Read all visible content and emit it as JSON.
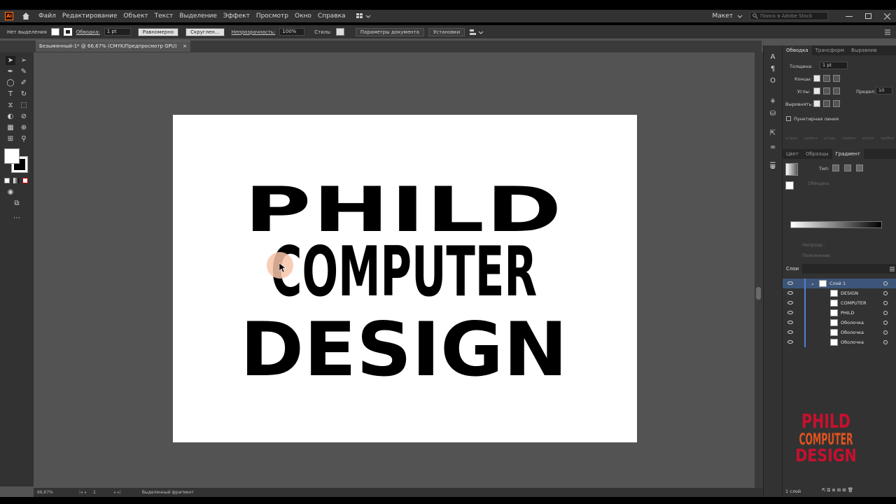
{
  "menubar": {
    "items": [
      "Файл",
      "Редактирование",
      "Объект",
      "Текст",
      "Выделение",
      "Эффект",
      "Просмотр",
      "Окно",
      "Справка"
    ],
    "workspace": "Макет",
    "search_placeholder": "Поиск в Adobe Stock",
    "app_logo": "Ai"
  },
  "controlbar": {
    "selection_label": "Нет выделения",
    "stroke_label": "Обводка:",
    "stroke_value": "1 pt",
    "profile_label": "Равномерно",
    "brush_label": "Скруглен...",
    "opacity_label": "Непрозрачность:",
    "opacity_value": "100%",
    "style_label": "Стиль:",
    "doc_settings": "Параметры документа",
    "preferences": "Установки"
  },
  "document_tab": "Безымянный-1* @ 66,67% (CMYK/Предпросмотр GPU)",
  "artwork": {
    "line1": "PHILD",
    "line2": "COMPUTER",
    "line3": "DESIGN"
  },
  "statusbar": {
    "zoom": "66,67%",
    "page": "1",
    "status": "Выделенный фрагмент"
  },
  "stroke_panel": {
    "tabs": [
      "Обводка",
      "Трансформ",
      "Выравнив"
    ],
    "weight_label": "Толщина:",
    "weight_value": "1 pt",
    "caps_label": "Концы:",
    "corners_label": "Углы:",
    "limit_label": "Предел:",
    "limit_value": "10",
    "align_label": "Выровнять:",
    "dashed_label": "Пунктирная линия",
    "dash_fields": [
      "штрих",
      "пробел",
      "штрих",
      "пробел",
      "штрих",
      "пробел"
    ]
  },
  "gradient_panel": {
    "tabs": [
      "Цвет",
      "Образцы",
      "Градиент"
    ],
    "type_label": "Тип:",
    "stroke_label": "Обводка:",
    "opacity_label": "Непрозр.:",
    "location_label": "Положение:"
  },
  "layers_panel": {
    "tab": "Слои",
    "layer_name": "Слой 1",
    "items": [
      "DESIGN",
      "COMPUTER",
      "PHILD",
      "Оболочка",
      "Оболочка",
      "Оболочка"
    ],
    "footer": "1 слой"
  },
  "watermark": {
    "line1": "PHILD",
    "line2": "COMPUTER",
    "line3": "DESIGN",
    "color1": "#c8102e",
    "color2": "#e0531e"
  },
  "colors": {
    "accent": "#4f7fd9",
    "menubar_bg": "#323232",
    "canvas_bg": "#535353"
  }
}
